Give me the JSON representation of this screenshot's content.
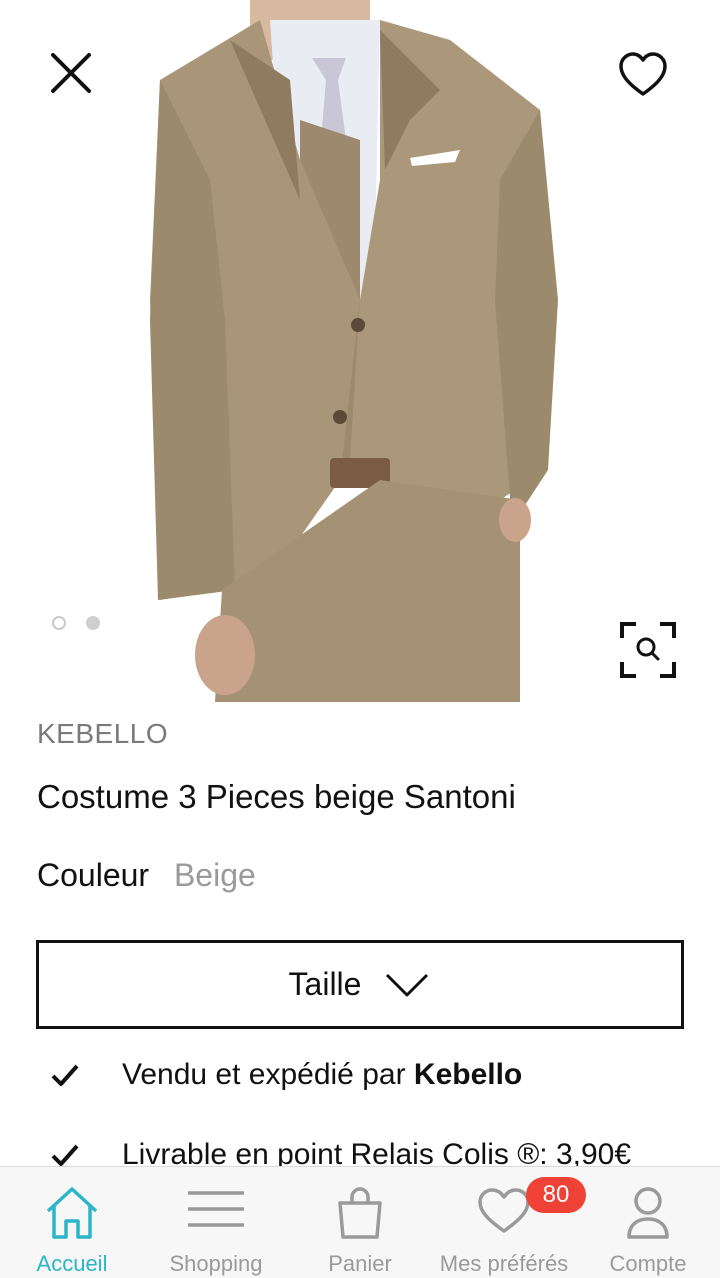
{
  "product": {
    "brand": "KEBELLO",
    "title": "Costume 3 Pieces beige Santoni",
    "color_label": "Couleur",
    "color_value": "Beige",
    "size_label": "Taille",
    "gallery": {
      "current_index": 2,
      "total": 2
    },
    "image_description": "Homme portant un costume 3 pièces beige"
  },
  "features": [
    {
      "text": "Vendu et expédié par ",
      "bold": "Kebello"
    },
    {
      "text": "Livrable en point Relais Colis ®: 3,90€"
    }
  ],
  "tabbar": {
    "items": [
      {
        "label": "Accueil",
        "icon": "home-icon",
        "active": true
      },
      {
        "label": "Shopping",
        "icon": "menu-icon"
      },
      {
        "label": "Panier",
        "icon": "bag-icon"
      },
      {
        "label": "Mes préférés",
        "icon": "heart-icon",
        "badge": "80"
      },
      {
        "label": "Compte",
        "icon": "user-icon"
      }
    ]
  },
  "colors": {
    "accent": "#2bb5c7",
    "badge": "#ef4136",
    "suit": "#a89478"
  }
}
